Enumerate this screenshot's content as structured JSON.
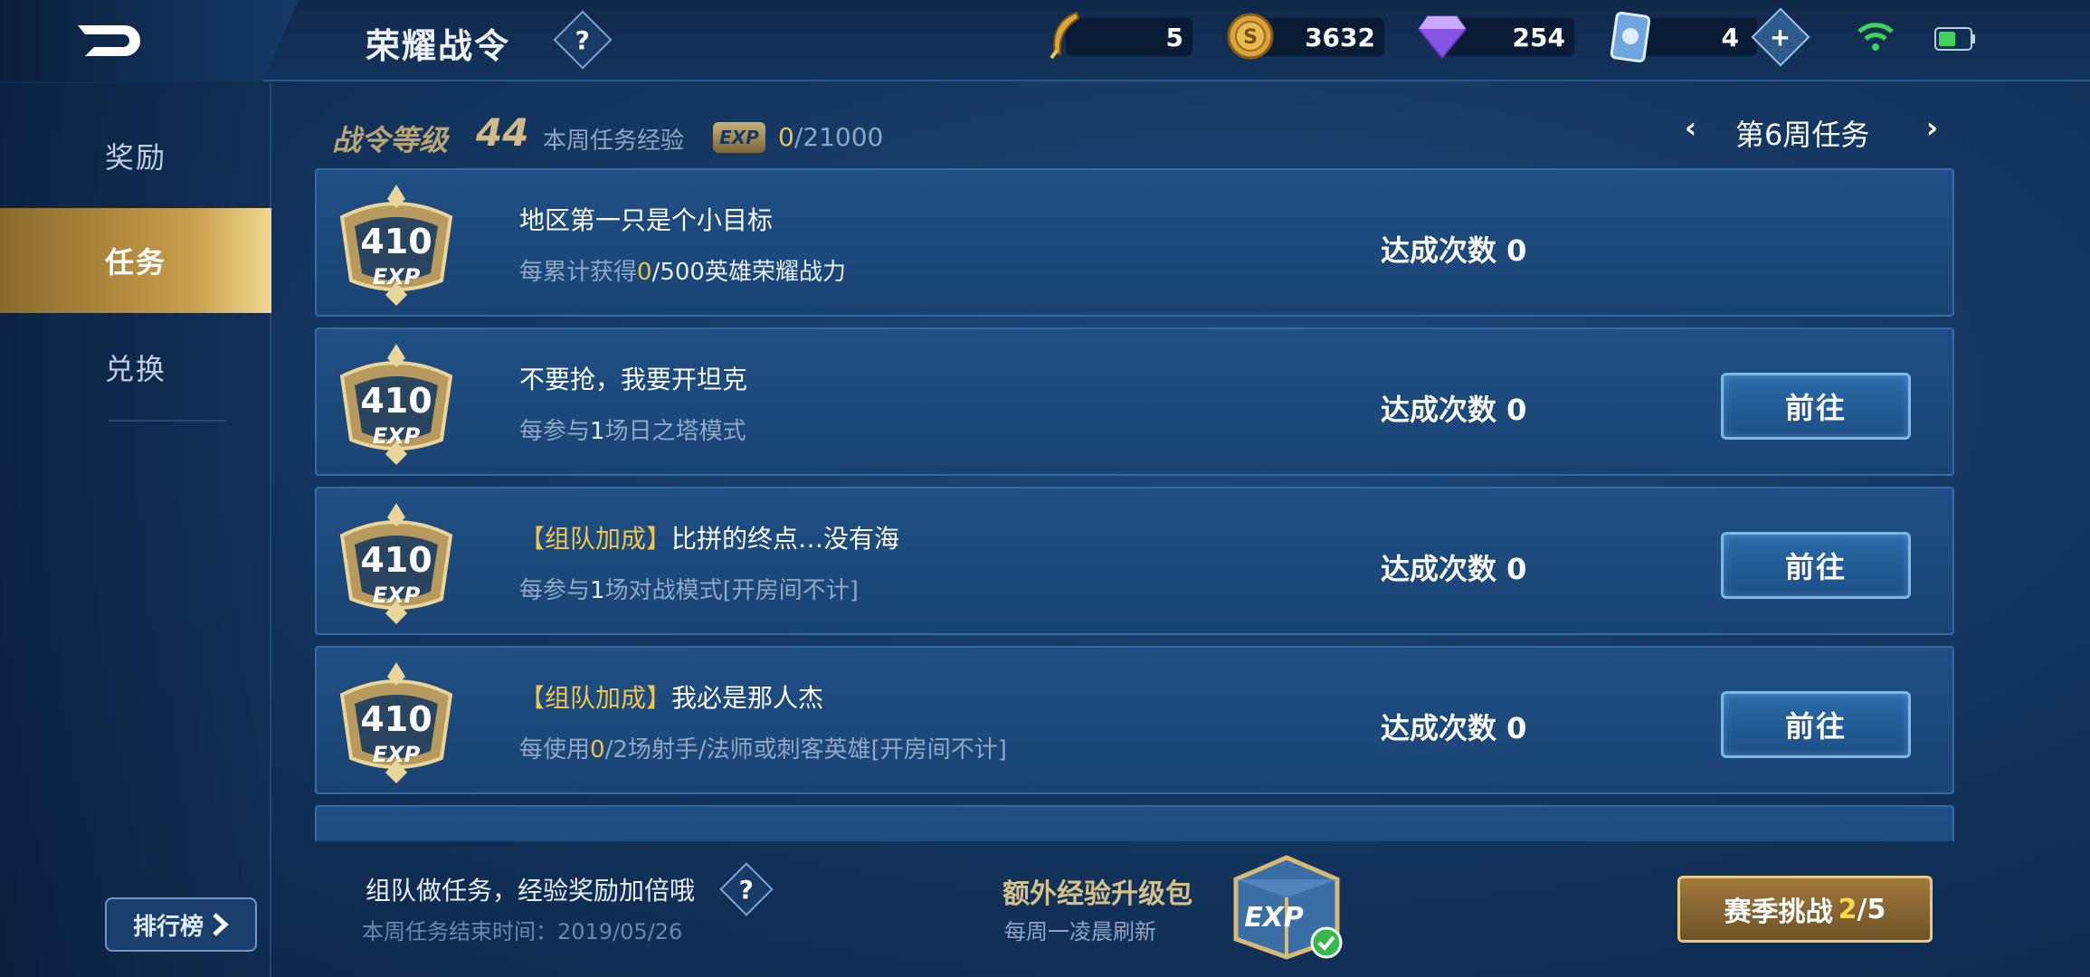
{
  "header": {
    "title": "荣耀战令",
    "help_label": "?",
    "resources": [
      {
        "name": "feather-icon",
        "value": "5"
      },
      {
        "name": "gold-coin-icon",
        "value": "3632"
      },
      {
        "name": "diamond-icon",
        "value": "254"
      },
      {
        "name": "card-icon",
        "value": "4"
      }
    ],
    "add_label": "+"
  },
  "sidebar": {
    "items": [
      {
        "label": "奖励",
        "active": false
      },
      {
        "label": "任务",
        "active": true
      },
      {
        "label": "兑换",
        "active": false
      }
    ],
    "rank_label": "排行榜"
  },
  "level": {
    "label": "战令等级",
    "value": "44",
    "week_exp_label": "本周任务经验",
    "exp_badge": "EXP",
    "week_exp_current": "0",
    "week_exp_total": "/21000"
  },
  "week_nav": {
    "prev": "‹",
    "label": "第6周任务",
    "next": "›"
  },
  "tasks": [
    {
      "exp": "410",
      "exp_label": "EXP",
      "tag": "",
      "title": "地区第一只是个小目标",
      "desc_pre": "每累计获得",
      "desc_cur": "0",
      "desc_post": "/500英雄荣耀战力",
      "count_label": "达成次数",
      "count": "0",
      "button": ""
    },
    {
      "exp": "410",
      "exp_label": "EXP",
      "tag": "",
      "title": "不要抢，我要开坦克",
      "desc_pre": "每参与",
      "desc_cur": "1",
      "desc_post": "场日之塔模式",
      "count_label": "达成次数",
      "count": "0",
      "button": "前往"
    },
    {
      "exp": "410",
      "exp_label": "EXP",
      "tag": "【组队加成】",
      "title": "比拼的终点…没有海",
      "desc_pre": "每参与",
      "desc_cur": "1",
      "desc_post": "场对战模式[开房间不计]",
      "count_label": "达成次数",
      "count": "0",
      "button": "前往"
    },
    {
      "exp": "410",
      "exp_label": "EXP",
      "tag": "【组队加成】",
      "title": "我必是那人杰",
      "desc_pre": "每使用",
      "desc_cur": "0",
      "desc_post": "/2场射手/法师或刺客英雄[开房间不计]",
      "count_label": "达成次数",
      "count": "0",
      "button": "前往"
    }
  ],
  "bottom": {
    "tip": "组队做任务，经验奖励加倍哦",
    "end_time": "本周任务结束时间：2019/05/26",
    "pack_title": "额外经验升级包",
    "pack_sub": "每周一凌晨刷新",
    "pack_exp": "EXP",
    "season_label": "赛季挑战",
    "season_current": "2",
    "season_total": "/5"
  }
}
